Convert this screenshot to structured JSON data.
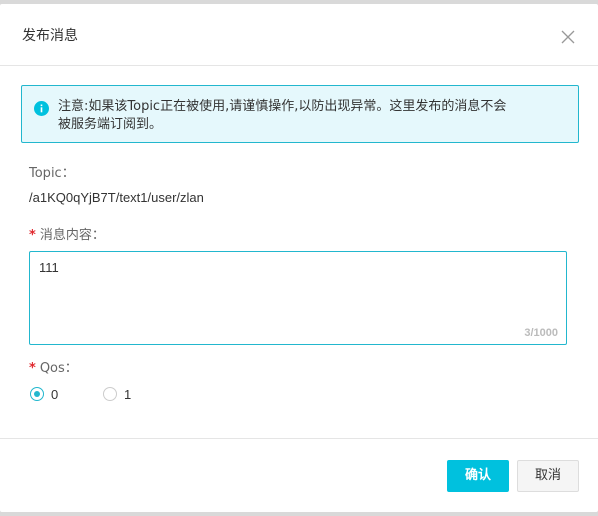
{
  "dialog": {
    "title": "发布消息",
    "close_icon": "close-icon"
  },
  "notice": {
    "icon": "info-icon",
    "line1": "注意:如果该Topic正在被使用,请谨慎操作,以防出现异常。这里发布的消息不会",
    "line2": "被服务端订阅到。",
    "accent": "#22b7ce",
    "background": "#e5f8fc"
  },
  "topic": {
    "label": "Topic：",
    "value": "/a1KQ0qYjB7T/text1/user/zlan"
  },
  "message": {
    "required_mark": "*",
    "label": "消息内容：",
    "value": "111",
    "char_count": "3/1000"
  },
  "qos": {
    "required_mark": "*",
    "label": "Qos：",
    "options": [
      {
        "label": "0",
        "checked": true
      },
      {
        "label": "1",
        "checked": false
      }
    ]
  },
  "footer": {
    "confirm_label": "确认",
    "cancel_label": "取消",
    "primary_color": "#00c1de"
  }
}
